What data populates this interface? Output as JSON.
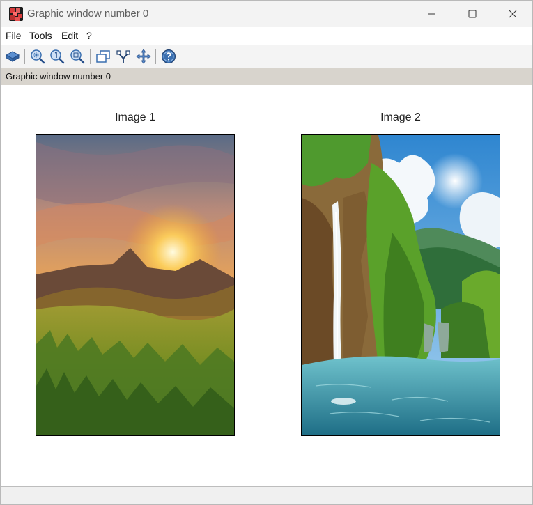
{
  "window": {
    "title": "Graphic window number 0"
  },
  "menu": [
    {
      "label": "File"
    },
    {
      "label": "Tools"
    },
    {
      "label": "Edit"
    },
    {
      "label": "?"
    }
  ],
  "toolbar": {
    "icons": [
      "rotate-3d-icon",
      "zoom-in-icon",
      "zoom-original-icon",
      "zoom-area-icon",
      "new-figure-icon",
      "data-tips-icon",
      "pan-icon",
      "help-icon"
    ]
  },
  "info_bar": {
    "text": "Graphic window number 0"
  },
  "figure": {
    "images": [
      {
        "title": "Image 1"
      },
      {
        "title": "Image 2"
      }
    ]
  },
  "colors": {
    "titlebar": "#f3f3f3",
    "infobar": "#d8d4cd",
    "toolbar_icon": "#3a6fb0"
  }
}
